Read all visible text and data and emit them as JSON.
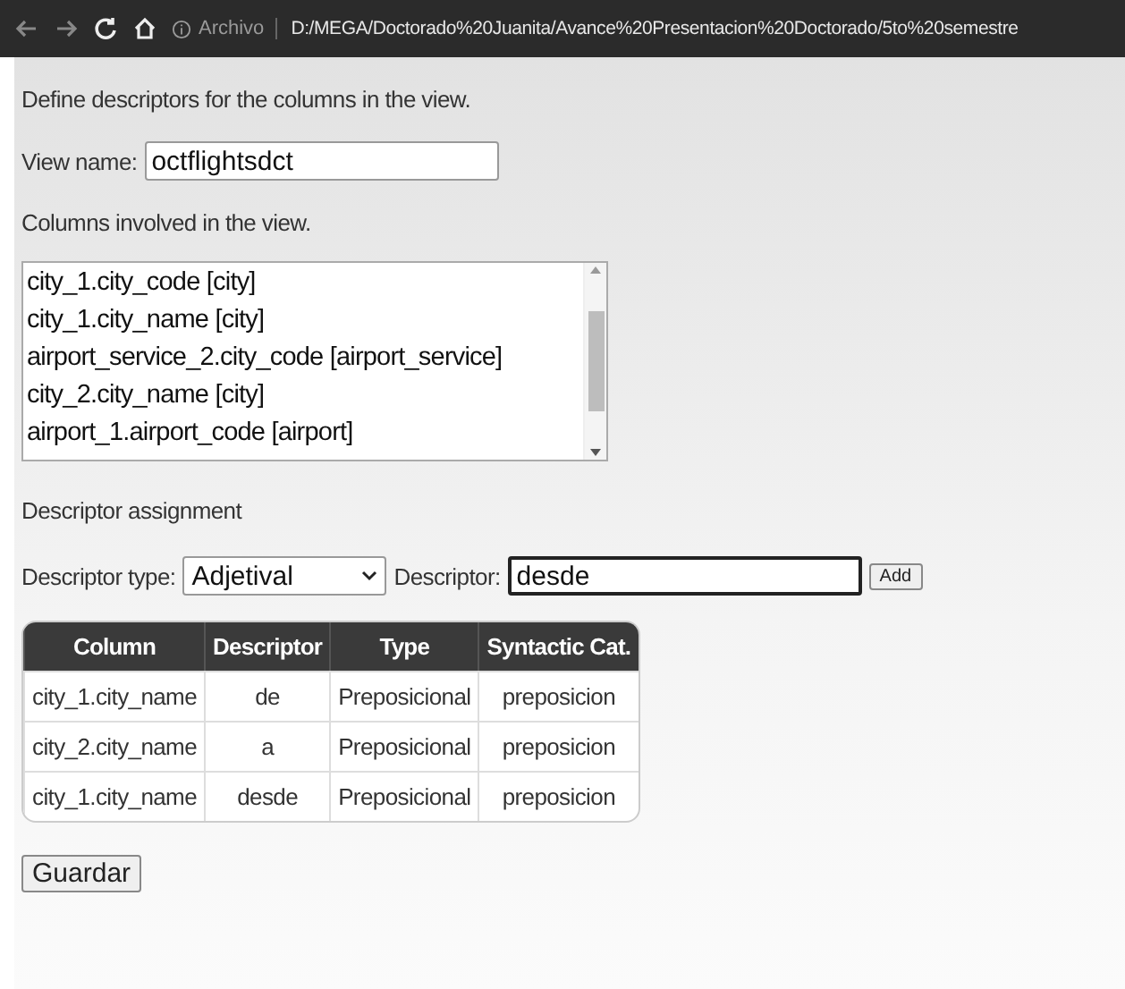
{
  "browser": {
    "security_label": "Archivo",
    "url": "D:/MEGA/Doctorado%20Juanita/Avance%20Presentacion%20Doctorado/5to%20semestre"
  },
  "intro": "Define descriptors for the columns in the view.",
  "view_name": {
    "label": "View name:",
    "value": "octflightsdct"
  },
  "columns_label": "Columns involved in the view.",
  "columns_list": [
    "city_1.city_code [city]",
    "city_1.city_name [city]",
    "airport_service_2.city_code [airport_service]",
    "city_2.city_name [city]",
    "airport_1.airport_code [airport]"
  ],
  "assignment_label": "Descriptor assignment",
  "descriptor_type": {
    "label": "Descriptor type:",
    "value": "Adjetival"
  },
  "descriptor": {
    "label": "Descriptor:",
    "value": "desde"
  },
  "add_button": "Add",
  "table": {
    "columns": [
      "Column",
      "Descriptor",
      "Type",
      "Syntactic Cat."
    ],
    "rows": [
      [
        "city_1.city_name",
        "de",
        "Preposicional",
        "preposicion"
      ],
      [
        "city_2.city_name",
        "a",
        "Preposicional",
        "preposicion"
      ],
      [
        "city_1.city_name",
        "desde",
        "Preposicional",
        "preposicion"
      ]
    ]
  },
  "save_button": "Guardar"
}
